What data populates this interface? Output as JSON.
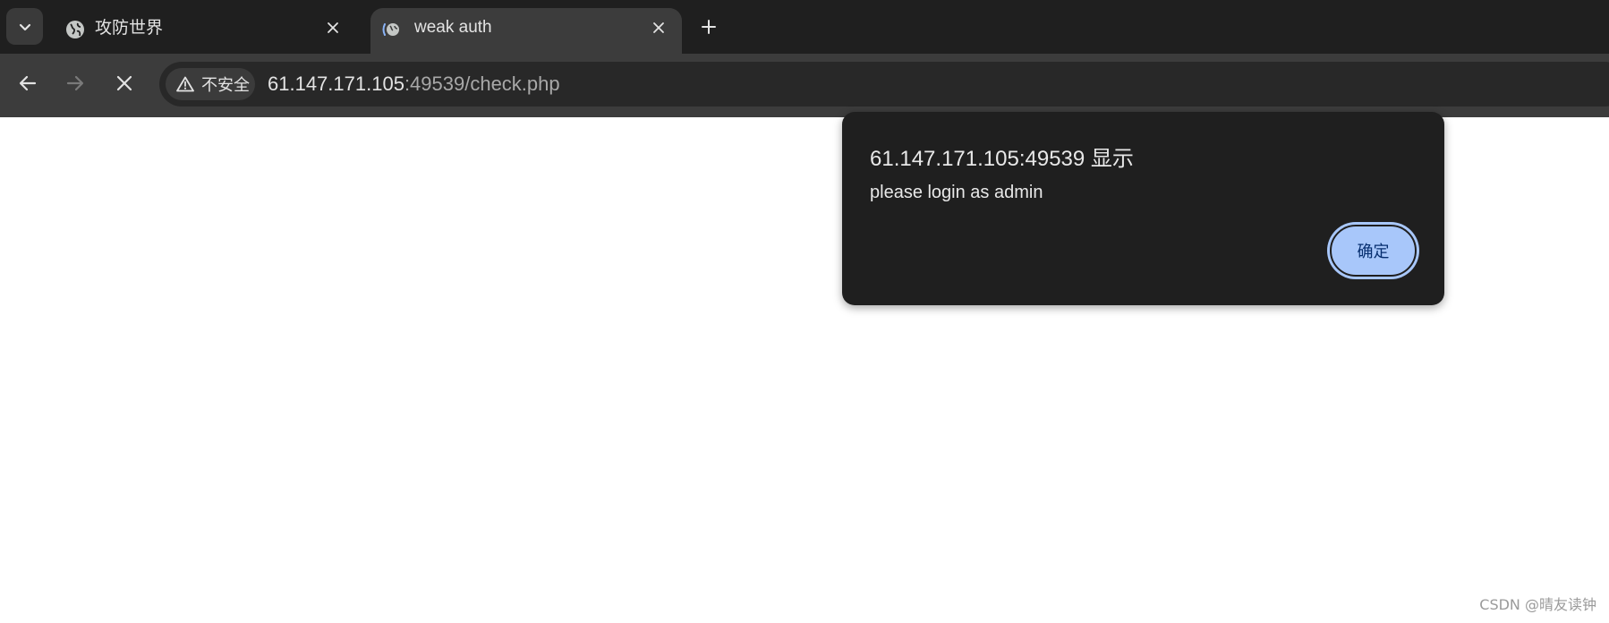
{
  "tabs": [
    {
      "title": "攻防世界",
      "favicon": "globe-icon",
      "active": false
    },
    {
      "title": "weak auth",
      "favicon": "loading-globe-icon",
      "active": true
    }
  ],
  "toolbar": {
    "security_label": "不安全",
    "url_host": "61.147.171.105",
    "url_rest": ":49539/check.php"
  },
  "dialog": {
    "title": "61.147.171.105:49539 显示",
    "message": "please login as admin",
    "ok_label": "确定"
  },
  "watermark": "CSDN @晴友读钟",
  "colors": {
    "tabstrip_bg": "#1f1f1f",
    "toolbar_bg": "#3c3c3c",
    "dialog_bg": "#1f1f1f",
    "button_accent": "#a8c7fa"
  }
}
